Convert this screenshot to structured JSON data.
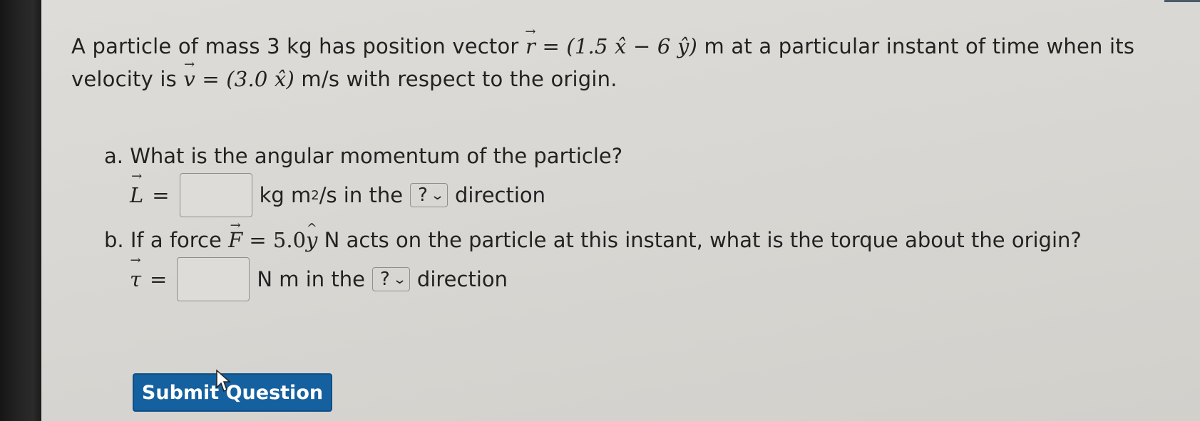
{
  "question": {
    "stem_part1": "A particle of mass 3 kg has position vector ",
    "stem_r_expr": "(1.5 x̂ − 6 ŷ)",
    "stem_part2": " m at a particular instant of time when its",
    "stem_part3": "velocity is ",
    "stem_v_expr": "(3.0 x̂)",
    "stem_part4": " m/s with respect to the origin."
  },
  "part_a": {
    "prompt": "a. What is the angular momentum of the particle?",
    "symbol": "L",
    "units_before": "kg m",
    "units_sup": "2",
    "units_after": "/s in the",
    "select_value": "?",
    "suffix": "direction"
  },
  "part_b": {
    "prompt_before": "b. If a force ",
    "force_expr": "= 5.0",
    "prompt_after": " N acts on the particle at this instant, what is the torque about the origin?",
    "symbol": "τ",
    "units": "N m in the",
    "select_value": "?",
    "suffix": "direction"
  },
  "submit_label": "Submit Question"
}
